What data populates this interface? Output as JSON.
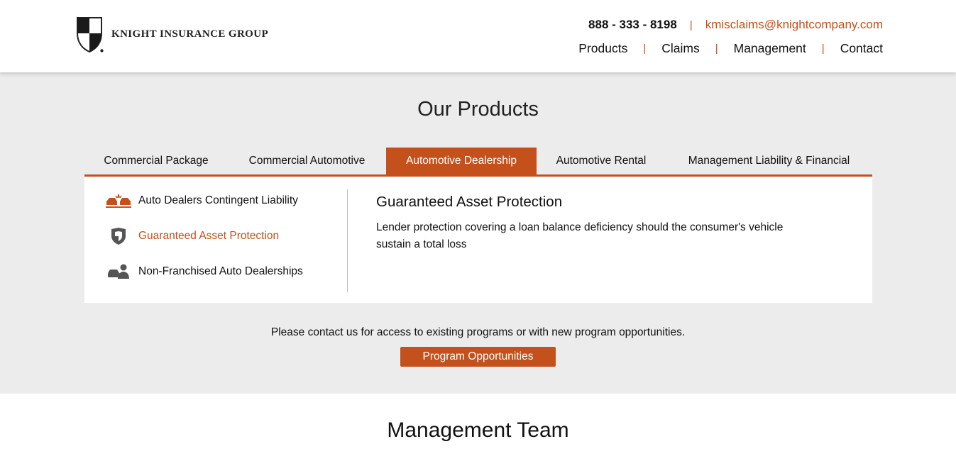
{
  "header": {
    "brand": "KNIGHT INSURANCE GROUP",
    "phone": "888 - 333 - 8198",
    "email": "kmisclaims@knightcompany.com",
    "nav": [
      "Products",
      "Claims",
      "Management",
      "Contact"
    ]
  },
  "products": {
    "title": "Our Products",
    "tabs": [
      {
        "label": "Commercial Package",
        "active": false
      },
      {
        "label": "Commercial Automotive",
        "active": false
      },
      {
        "label": "Automotive Dealership",
        "active": true
      },
      {
        "label": "Automotive Rental",
        "active": false
      },
      {
        "label": "Management Liability & Financial",
        "active": false
      }
    ],
    "side_items": [
      {
        "label": "Auto Dealers Contingent Liability",
        "icon": "car-crash-icon",
        "active": false
      },
      {
        "label": "Guaranteed Asset Protection",
        "icon": "shield-icon",
        "active": true
      },
      {
        "label": "Non-Franchised Auto Dealerships",
        "icon": "car-person-icon",
        "active": false
      }
    ],
    "detail": {
      "title": "Guaranteed Asset Protection",
      "text": "Lender protection covering a loan balance deficiency should the consumer's vehicle sustain a total loss"
    },
    "contact_text": "Please contact us for access to existing programs or with new program opportunities.",
    "cta_label": "Program Opportunities"
  },
  "management": {
    "title": "Management Team"
  },
  "colors": {
    "accent": "#c4501c",
    "section_bg": "#ececec",
    "icon_gray": "#555555"
  }
}
